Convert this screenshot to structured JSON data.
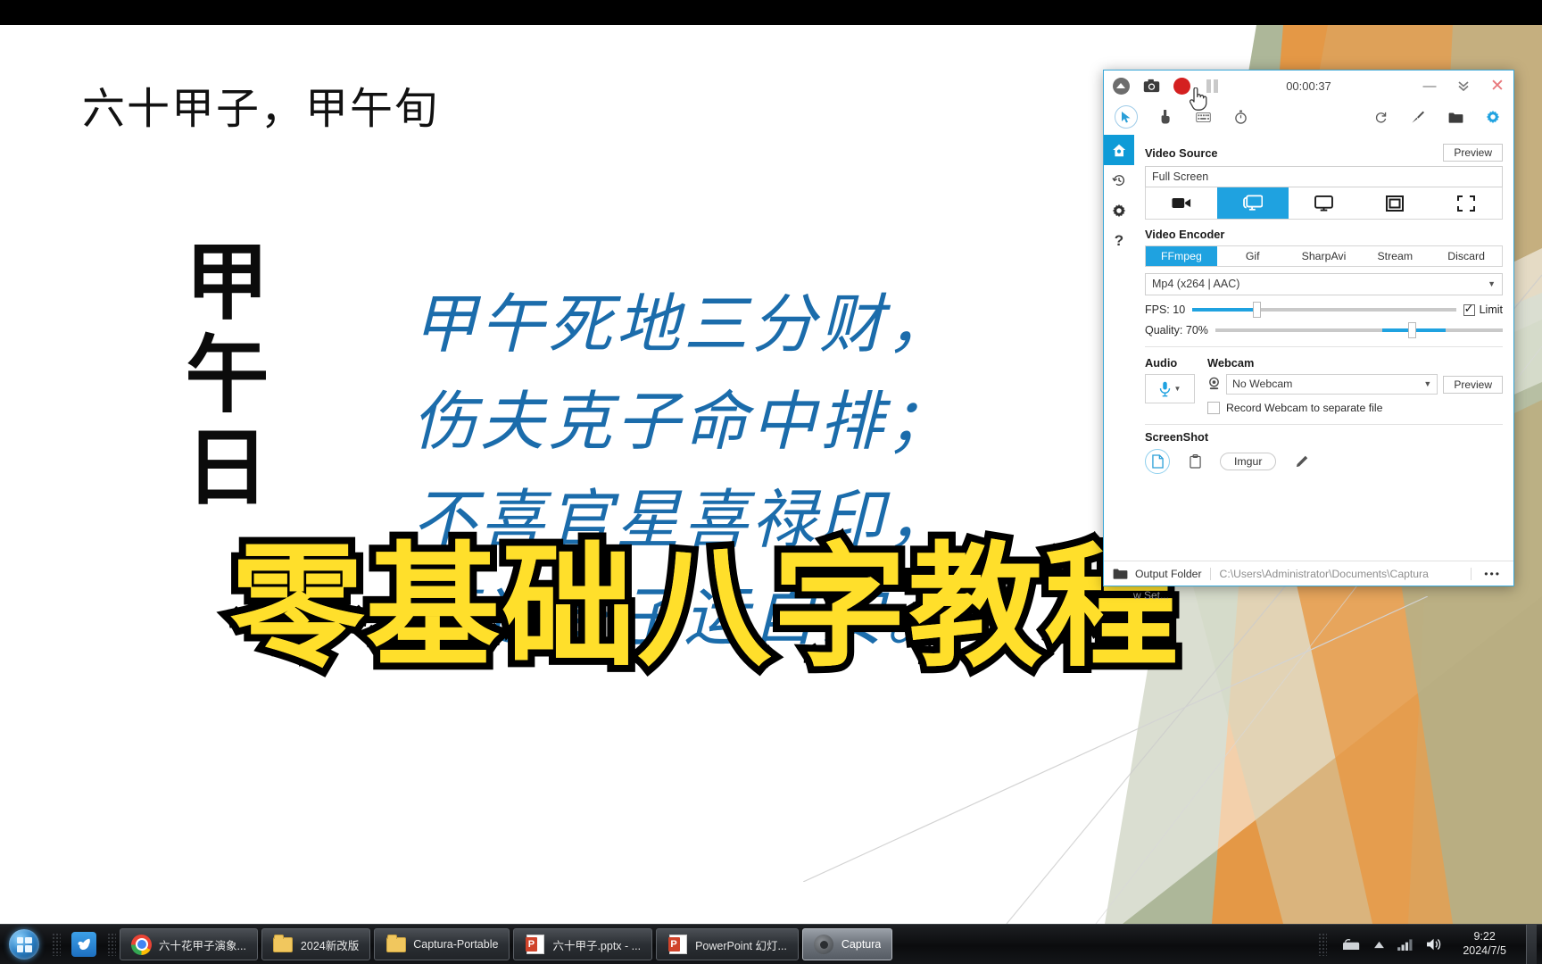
{
  "slide": {
    "title": "六十甲子，甲午旬",
    "vertical_chars": "甲午日",
    "poem_lines": [
      "甲午死地三分财，",
      "伤夫克子命中排；",
      "不喜官星喜禄印，",
      "喜逢亥子运自安。"
    ],
    "overlay_headline": "零基础八字教程"
  },
  "captura": {
    "titlebar": {
      "collapse_icon": "circle-up-icon",
      "screenshot_icon": "camera-icon",
      "record_icon": "record-dot-icon",
      "pause_icon": "pause-icon",
      "timer": "00:00:37",
      "minimize_icon": "minimize-icon",
      "collapse_down_icon": "chevron-double-down-icon",
      "close_icon": "close-icon"
    },
    "toolbar": {
      "cursor_icon": "cursor-icon",
      "click_icon": "hand-click-icon",
      "keystrokes_icon": "keyboard-icon",
      "timer_icon": "stopwatch-icon",
      "refresh_icon": "refresh-icon",
      "theme_icon": "brush-icon",
      "folder_icon": "folder-icon",
      "settings_icon": "gear-icon"
    },
    "sidebar": [
      {
        "name": "home",
        "icon": "home-icon",
        "active": true
      },
      {
        "name": "history",
        "icon": "history-icon",
        "active": false
      },
      {
        "name": "settings",
        "icon": "gear-icon",
        "active": false
      },
      {
        "name": "help",
        "icon": "question-icon",
        "active": false
      }
    ],
    "video_source": {
      "heading": "Video Source",
      "preview_label": "Preview",
      "value": "Full Screen",
      "modes": [
        {
          "icon": "video-camera-icon",
          "selected": false
        },
        {
          "icon": "screen-icon",
          "selected": true
        },
        {
          "icon": "desktop-icon",
          "selected": false
        },
        {
          "icon": "window-icon",
          "selected": false
        },
        {
          "icon": "region-icon",
          "selected": false
        }
      ]
    },
    "video_encoder": {
      "heading": "Video Encoder",
      "tabs": [
        "FFmpeg",
        "Gif",
        "SharpAvi",
        "Stream",
        "Discard"
      ],
      "selected_tab": "FFmpeg",
      "format": "Mp4 (x264 | AAC)",
      "fps_label": "FPS:",
      "fps_value": "10",
      "fps_percent": 26,
      "limit_label": "Limit",
      "limit_checked": true,
      "quality_label": "Quality:",
      "quality_value": "70%",
      "quality_percent": 70
    },
    "audio": {
      "heading": "Audio",
      "mic_icon": "microphone-icon"
    },
    "webcam": {
      "heading": "Webcam",
      "icon": "webcam-icon",
      "value": "No Webcam",
      "preview_label": "Preview",
      "record_separate_label": "Record Webcam to separate file",
      "record_separate_checked": false
    },
    "screenshot": {
      "heading": "ScreenShot",
      "disk_icon": "file-icon",
      "clipboard_icon": "clipboard-icon",
      "imgur_label": "Imgur",
      "edit_icon": "pencil-icon"
    },
    "footer": {
      "folder_icon": "folder-icon",
      "label": "Output Folder",
      "path": "C:\\Users\\Administrator\\Documents\\Captura",
      "more_label": "•••"
    },
    "ghost_text": "w Set..."
  },
  "taskbar": {
    "start_icon": "windows-start-icon",
    "quick_launch": [
      {
        "name": "dove-app",
        "icon": "dove-icon",
        "glyph": "🕊"
      }
    ],
    "items": [
      {
        "label": "六十花甲子演象...",
        "icon": "chrome-icon",
        "active": false
      },
      {
        "label": "2024新改版",
        "icon": "folder-icon",
        "active": false
      },
      {
        "label": "Captura-Portable",
        "icon": "folder-icon",
        "active": false
      },
      {
        "label": "六十甲子.pptx - ...",
        "icon": "powerpoint-icon",
        "active": false
      },
      {
        "label": "PowerPoint 幻灯...",
        "icon": "powerpoint-icon",
        "active": false
      },
      {
        "label": "Captura",
        "icon": "captura-icon",
        "active": true
      }
    ],
    "tray": [
      {
        "name": "input-method-icon"
      },
      {
        "name": "show-hidden-icons-arrow"
      },
      {
        "name": "network-signal-icon"
      },
      {
        "name": "volume-icon"
      }
    ],
    "clock_time": "9:22",
    "clock_date": "2024/7/5"
  },
  "colors": {
    "accent_blue": "#1fa2e0",
    "record_red": "#d42020",
    "poem_blue": "#1b6cab",
    "headline_yellow": "#ffdf2b"
  }
}
